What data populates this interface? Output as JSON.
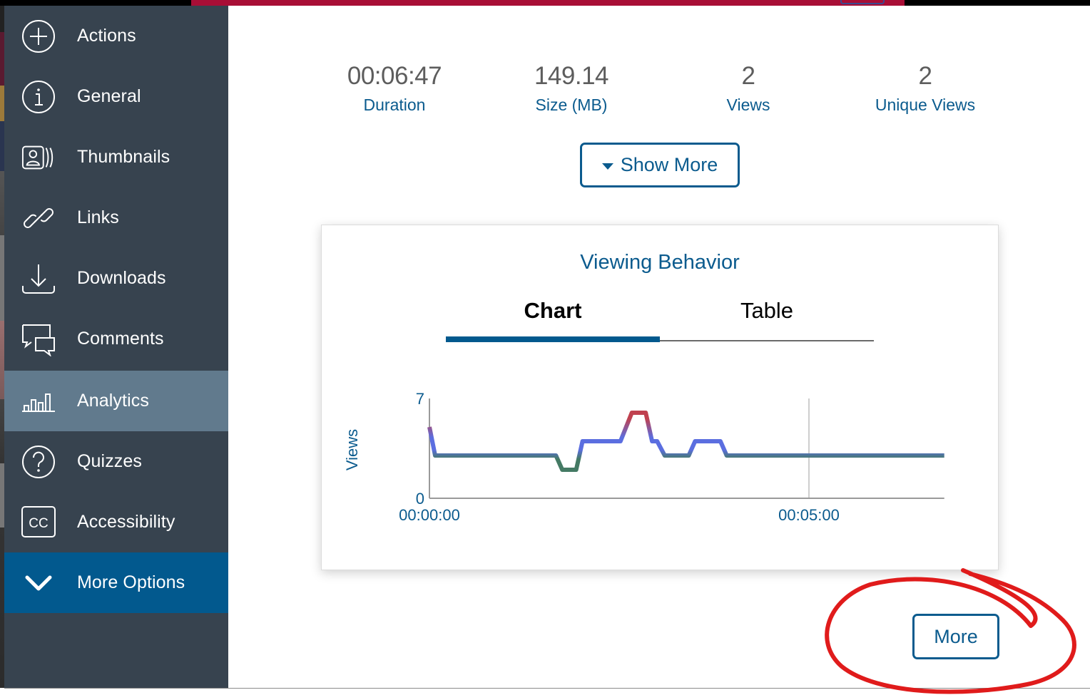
{
  "sidebar": {
    "items": [
      {
        "label": "Actions",
        "icon": "plus-circle-icon"
      },
      {
        "label": "General",
        "icon": "info-circle-icon"
      },
      {
        "label": "Thumbnails",
        "icon": "thumbnails-icon"
      },
      {
        "label": "Links",
        "icon": "link-icon"
      },
      {
        "label": "Downloads",
        "icon": "download-icon"
      },
      {
        "label": "Comments",
        "icon": "comments-icon"
      },
      {
        "label": "Analytics",
        "icon": "analytics-icon",
        "active": true
      },
      {
        "label": "Quizzes",
        "icon": "question-circle-icon"
      },
      {
        "label": "Accessibility",
        "icon": "closed-captions-icon"
      },
      {
        "label": "More Options",
        "icon": "chevron-down-icon"
      }
    ],
    "cc_glyph": "CC"
  },
  "stats": [
    {
      "value": "00:06:47",
      "label": "Duration"
    },
    {
      "value": "149.14",
      "label": "Size (MB)"
    },
    {
      "value": "2",
      "label": "Views"
    },
    {
      "value": "2",
      "label": "Unique Views"
    }
  ],
  "buttons": {
    "show_more": "Show More",
    "more": "More"
  },
  "card": {
    "title": "Viewing Behavior",
    "tabs": [
      {
        "label": "Chart",
        "active": true
      },
      {
        "label": "Table",
        "active": false
      }
    ]
  },
  "colors": {
    "sidebar_bg": "#37434f",
    "sidebar_active": "#617a8d",
    "more_options_bg": "#02598e",
    "accent": "#0b5b8e",
    "topbar_red": "#a80e36",
    "line_low": "#447a64",
    "line_mid": "#5b6ee0",
    "line_high": "#c0414f",
    "annotation_red": "#e01b1b"
  },
  "chart_data": {
    "type": "line",
    "title": "Viewing Behavior",
    "xlabel": "",
    "ylabel": "Views",
    "ylim": [
      0,
      7
    ],
    "xlim_seconds": [
      0,
      407
    ],
    "y_ticks": [
      "0",
      "7"
    ],
    "x_ticks": [
      {
        "seconds": 0,
        "label": "00:00:00"
      },
      {
        "seconds": 300,
        "label": "00:05:00"
      }
    ],
    "grid": "vertical line at 00:05:00",
    "series": [
      {
        "name": "Views",
        "x_seconds": [
          0,
          4.5,
          100,
          105,
          116,
          121,
          151,
          160,
          171,
          176,
          180,
          186,
          205,
          210,
          230,
          235,
          407
        ],
        "values": [
          5,
          3,
          3,
          2,
          2,
          4,
          4,
          6,
          6,
          4,
          4,
          3,
          3,
          4,
          4,
          3,
          3
        ]
      }
    ]
  }
}
